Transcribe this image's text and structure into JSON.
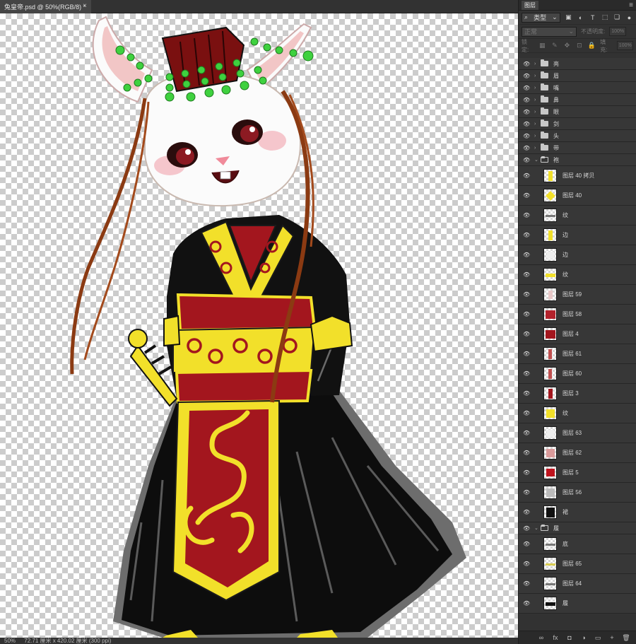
{
  "document": {
    "tab_title": "兔皇帝.psd @ 50%(RGB/8) *",
    "close_glyph": "×"
  },
  "status": {
    "zoom": "50%",
    "dimensions": "72.71 厘米 x 420.02 厘米 (300 ppi)"
  },
  "layers_panel": {
    "title": "图层",
    "menu_glyph": "≡",
    "filter_label": "类型",
    "blend_mode": "正常",
    "opacity_label": "不透明度:",
    "opacity_value": "100%",
    "lock_label": "锁定:",
    "fill_label": "填充:",
    "fill_value": "100%",
    "icons": {
      "search": "⌕",
      "filter_pixel": "▣",
      "filter_adjust": "◐",
      "filter_type": "T",
      "filter_shape": "⬚",
      "filter_smart": "❏",
      "filter_toggle": "●",
      "lock_transparent": "▦",
      "lock_paint": "✎",
      "lock_move": "✥",
      "lock_artboard": "⊡",
      "lock_all": "🔒"
    },
    "layers": [
      {
        "type": "group",
        "name": "亮",
        "open": false
      },
      {
        "type": "group",
        "name": "眉",
        "open": false
      },
      {
        "type": "group",
        "name": "嘴",
        "open": false
      },
      {
        "type": "group",
        "name": "鼻",
        "open": false
      },
      {
        "type": "group",
        "name": "眼",
        "open": false
      },
      {
        "type": "group",
        "name": "剑",
        "open": false
      },
      {
        "type": "group",
        "name": "头",
        "open": false
      },
      {
        "type": "group",
        "name": "带",
        "open": false
      },
      {
        "type": "group",
        "name": "袍",
        "open": true
      },
      {
        "type": "layer",
        "name": "图层 40 拷贝",
        "thumb": "yellow-bar"
      },
      {
        "type": "layer",
        "name": "图层 40",
        "thumb": "yellow-diag"
      },
      {
        "type": "layer",
        "name": "纹",
        "thumb": "gray-strip"
      },
      {
        "type": "layer",
        "name": "边",
        "thumb": "yellow-bar"
      },
      {
        "type": "layer",
        "name": "边",
        "thumb": "light"
      },
      {
        "type": "layer",
        "name": "纹",
        "thumb": "yellow-band"
      },
      {
        "type": "layer",
        "name": "图层 59",
        "thumb": "red-small"
      },
      {
        "type": "layer",
        "name": "图层 58",
        "thumb": "red-pattern"
      },
      {
        "type": "layer",
        "name": "图层 4",
        "thumb": "red-fill"
      },
      {
        "type": "layer",
        "name": "图层 61",
        "thumb": "red-thin"
      },
      {
        "type": "layer",
        "name": "图层 60",
        "thumb": "red-thin"
      },
      {
        "type": "layer",
        "name": "图层 3",
        "thumb": "red-tall"
      },
      {
        "type": "layer",
        "name": "纹",
        "thumb": "yellow-pattern"
      },
      {
        "type": "layer",
        "name": "图层 63",
        "thumb": "light"
      },
      {
        "type": "layer",
        "name": "图层 62",
        "thumb": "red-sketch"
      },
      {
        "type": "layer",
        "name": "图层 5",
        "thumb": "red-heart"
      },
      {
        "type": "layer",
        "name": "图层 56",
        "thumb": "gray-sketch"
      },
      {
        "type": "layer",
        "name": "裙",
        "thumb": "black-shape"
      },
      {
        "type": "group",
        "name": "履",
        "open": true
      },
      {
        "type": "layer",
        "name": "底",
        "thumb": "gray-strip"
      },
      {
        "type": "layer",
        "name": "图层 65",
        "thumb": "yellow-strip"
      },
      {
        "type": "layer",
        "name": "图层 64",
        "thumb": "gray-strip"
      },
      {
        "type": "layer",
        "name": "履",
        "thumb": "black-strip"
      }
    ],
    "footer_icons": [
      "∞",
      "fx",
      "◘",
      "◑",
      "▭",
      "+",
      "🗑"
    ]
  },
  "colors": {
    "panel_bg": "#323232",
    "robe_black": "#111111",
    "robe_red": "#a3161e",
    "gold": "#f2e02a",
    "jade": "#3fd13f",
    "hair": "#8b3a12"
  }
}
